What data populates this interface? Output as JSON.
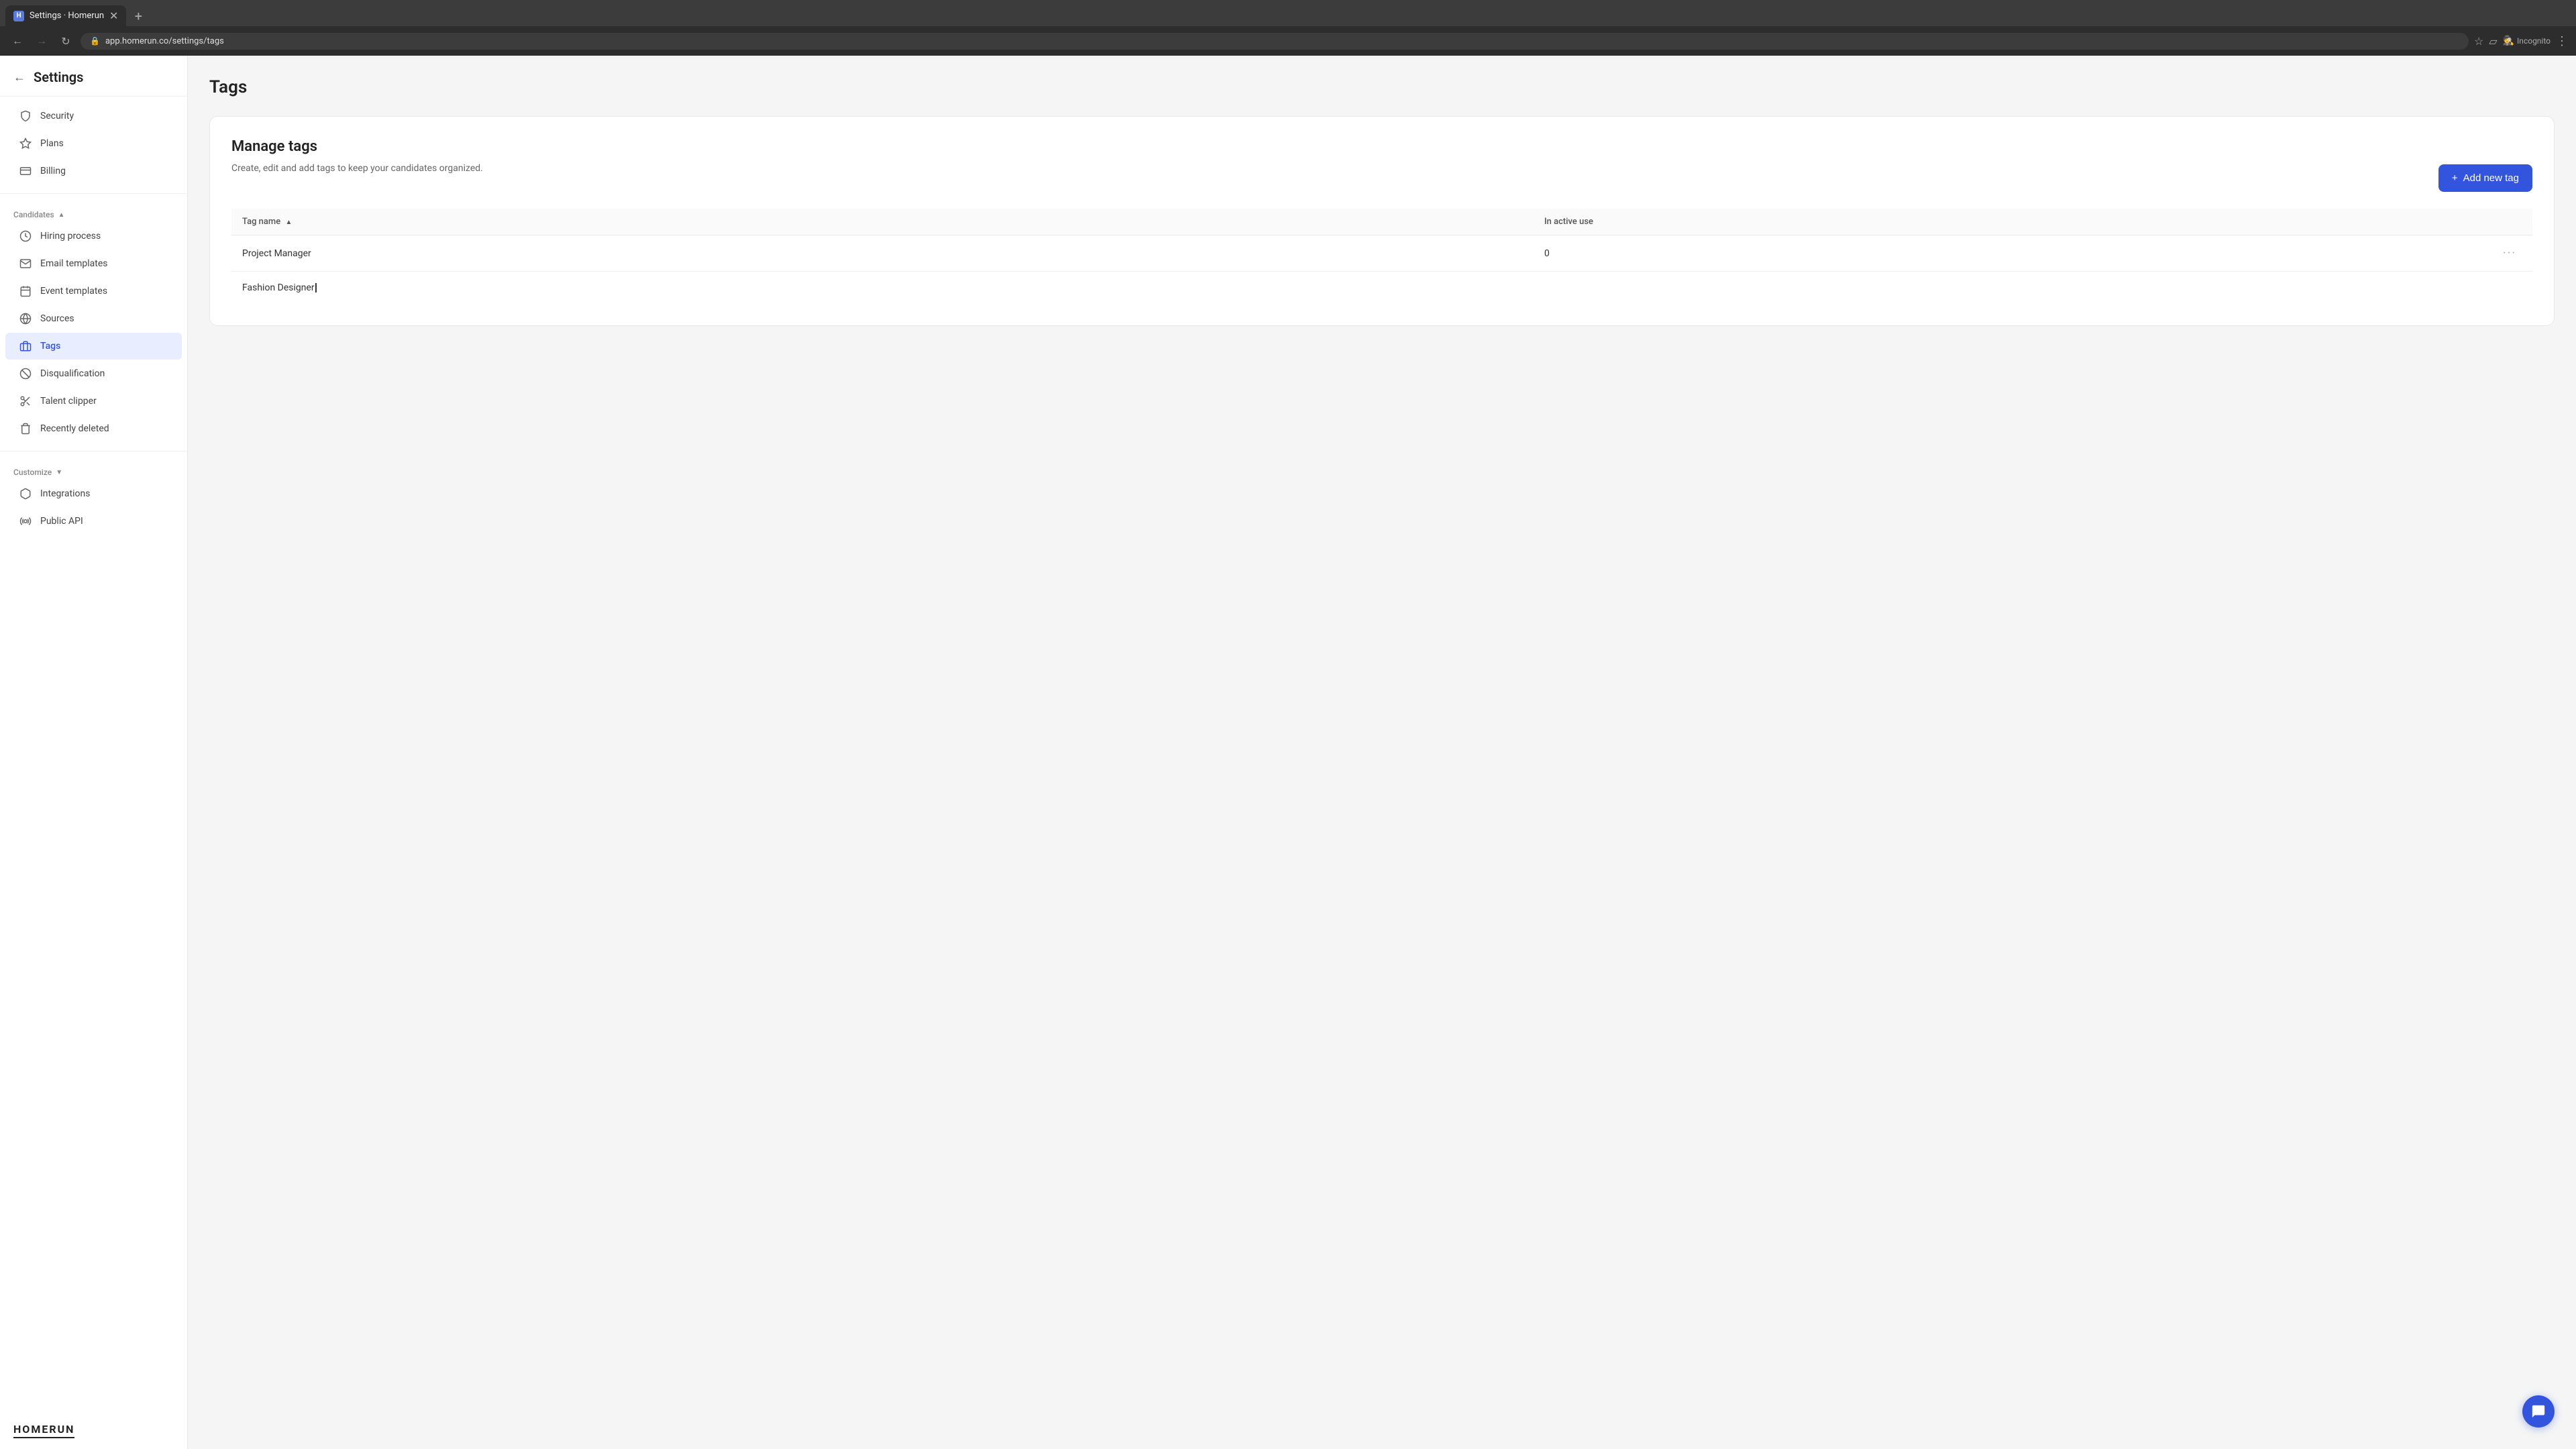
{
  "browser": {
    "tab": {
      "favicon": "H",
      "title": "Settings · Homerun",
      "url": "app.homerun.co/settings/tags"
    },
    "incognito_label": "Incognito"
  },
  "sidebar": {
    "back_label": "←",
    "title": "Settings",
    "top_items": [
      {
        "id": "security",
        "label": "Security",
        "icon": "⊙"
      },
      {
        "id": "plans",
        "label": "Plans",
        "icon": "⬡"
      },
      {
        "id": "billing",
        "label": "Billing",
        "icon": "▦"
      }
    ],
    "candidates_section_label": "Candidates",
    "candidates_items": [
      {
        "id": "hiring-process",
        "label": "Hiring process",
        "icon": "⊙"
      },
      {
        "id": "email-templates",
        "label": "Email templates",
        "icon": "✉"
      },
      {
        "id": "event-templates",
        "label": "Event templates",
        "icon": "▦"
      },
      {
        "id": "sources",
        "label": "Sources",
        "icon": "⊙"
      },
      {
        "id": "tags",
        "label": "Tags",
        "icon": "▭",
        "active": true
      },
      {
        "id": "disqualification",
        "label": "Disqualification",
        "icon": "⊗"
      },
      {
        "id": "talent-clipper",
        "label": "Talent clipper",
        "icon": "✂"
      },
      {
        "id": "recently-deleted",
        "label": "Recently deleted",
        "icon": "▦"
      }
    ],
    "customize_section_label": "Customize",
    "customize_items": [
      {
        "id": "integrations",
        "label": "Integrations",
        "icon": "✦"
      },
      {
        "id": "public-api",
        "label": "Public API",
        "icon": "⊙"
      }
    ],
    "logo": "HOMERUN"
  },
  "page": {
    "title": "Tags",
    "card": {
      "title": "Manage tags",
      "description": "Create, edit and add tags to keep your candidates organized.",
      "add_button_label": "Add new tag",
      "table": {
        "columns": [
          {
            "id": "tag-name",
            "label": "Tag name",
            "sortable": true,
            "sort_dir": "asc"
          },
          {
            "id": "in-active-use",
            "label": "In active use"
          }
        ],
        "rows": [
          {
            "tag_name": "Project Manager",
            "in_active_use": "0"
          },
          {
            "tag_name": "Fashion Designer",
            "in_active_use": ""
          }
        ]
      }
    }
  }
}
